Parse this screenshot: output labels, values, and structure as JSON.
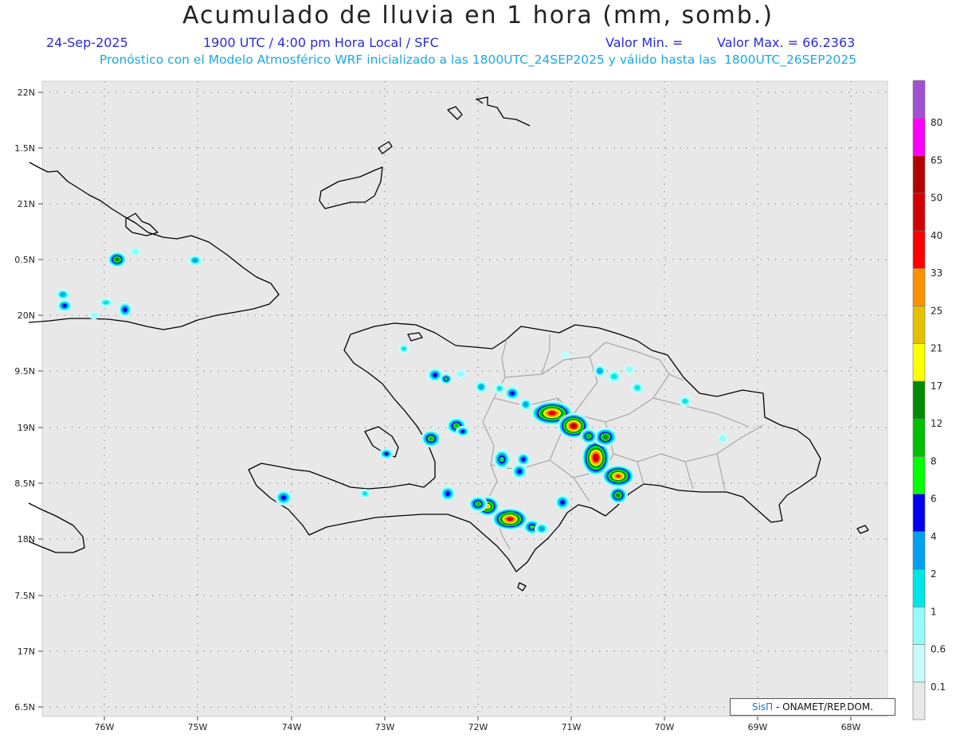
{
  "header": {
    "title": "Acumulado de lluvia en 1 hora (mm, somb.)",
    "date": "24-Sep-2025",
    "time_info": "1900 UTC / 4:00 pm Hora Local / SFC",
    "valor_min": "Valor Min. =",
    "valor_max": "Valor Max. = 66.2363",
    "model_info": "Pronóstico con el Modelo Atmosférico WRF inicializado a las 1800UTC_24SEP2025 y válido hasta las  1800UTC_26SEP2025"
  },
  "map": {
    "background_color": "#e8e8e8",
    "lon_labels": [
      "76W",
      "75W",
      "74W",
      "73W",
      "72W",
      "71W",
      "70W",
      "69W",
      "68W"
    ],
    "lat_labels": [
      "22N",
      "1.5N",
      "21N",
      "0.5N",
      "20N",
      "9.5N",
      "19N",
      "8.5N",
      "18N",
      "7.5N",
      "17N",
      "6.5N"
    ],
    "lon_range": [
      -76.7,
      -67.6
    ],
    "lat_range": [
      16.45,
      22.05
    ]
  },
  "colorbar": {
    "labels": [
      "0.1",
      "0.6",
      "1",
      "2",
      "4",
      "6",
      "8",
      "12",
      "17",
      "21",
      "25",
      "33",
      "40",
      "50",
      "65",
      "80"
    ],
    "colors": [
      "#e8e8e8",
      "#c8fafa",
      "#96fafa",
      "#00e6e6",
      "#00a0f0",
      "#0000f0",
      "#00ff00",
      "#00c000",
      "#008c00",
      "#ffff00",
      "#e6c000",
      "#ff9000",
      "#ff0000",
      "#d20000",
      "#b40000",
      "#ff00ff",
      "#a050d0"
    ]
  },
  "credit": {
    "brand": "SisΠ",
    "text": " - ONAMET/REP.DOM."
  }
}
